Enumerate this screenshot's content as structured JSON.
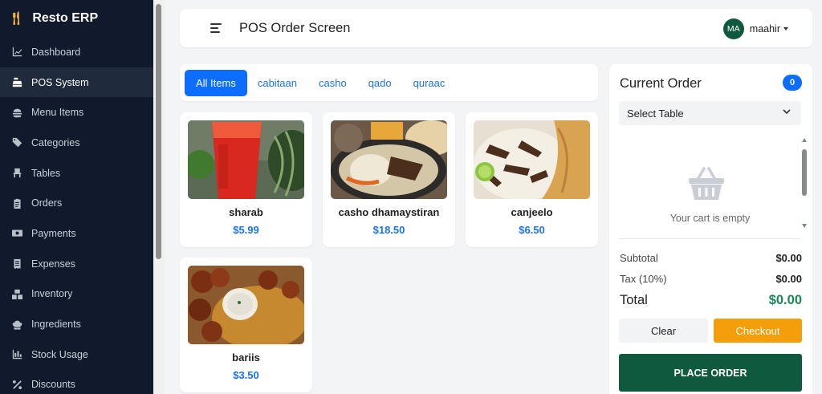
{
  "app": {
    "brand": "Resto ERP",
    "brand_icon": "utensils-icon"
  },
  "sidebar": {
    "items": [
      {
        "label": "Dashboard",
        "icon": "chart-line-icon",
        "active": false
      },
      {
        "label": "POS System",
        "icon": "cash-register-icon",
        "active": true
      },
      {
        "label": "Menu Items",
        "icon": "burger-icon",
        "active": false
      },
      {
        "label": "Categories",
        "icon": "tags-icon",
        "active": false
      },
      {
        "label": "Tables",
        "icon": "chair-icon",
        "active": false
      },
      {
        "label": "Orders",
        "icon": "clipboard-icon",
        "active": false
      },
      {
        "label": "Payments",
        "icon": "money-bill-icon",
        "active": false
      },
      {
        "label": "Expenses",
        "icon": "receipt-icon",
        "active": false
      },
      {
        "label": "Inventory",
        "icon": "boxes-icon",
        "active": false
      },
      {
        "label": "Ingredients",
        "icon": "chef-hat-icon",
        "active": false
      },
      {
        "label": "Stock Usage",
        "icon": "chart-bar-icon",
        "active": false
      },
      {
        "label": "Discounts",
        "icon": "percent-icon",
        "active": false
      }
    ]
  },
  "header": {
    "title": "POS Order Screen",
    "user_initials": "MA",
    "user_name": "maahir"
  },
  "categories": {
    "tabs": [
      {
        "label": "All Items",
        "active": true
      },
      {
        "label": "cabitaan",
        "active": false
      },
      {
        "label": "casho",
        "active": false
      },
      {
        "label": "qado",
        "active": false
      },
      {
        "label": "quraac",
        "active": false
      }
    ]
  },
  "menu": {
    "items": [
      {
        "name": "sharab",
        "price": "$5.99"
      },
      {
        "name": "casho dhamaystiran",
        "price": "$18.50"
      },
      {
        "name": "canjeelo",
        "price": "$6.50"
      },
      {
        "name": "bariis",
        "price": "$3.50"
      }
    ]
  },
  "order": {
    "title": "Current Order",
    "count": "0",
    "table_select": "Select Table",
    "empty_text": "Your cart is empty",
    "subtotal_label": "Subtotal",
    "subtotal": "$0.00",
    "tax_label": "Tax (10%)",
    "tax": "$0.00",
    "total_label": "Total",
    "total": "$0.00",
    "clear_label": "Clear",
    "checkout_label": "Checkout",
    "place_label": "PLACE ORDER"
  },
  "colors": {
    "primary": "#0d6efd",
    "sidebar": "#111a2c",
    "success": "#0f5a3e",
    "warning": "#f59e0b",
    "total": "#198754"
  }
}
